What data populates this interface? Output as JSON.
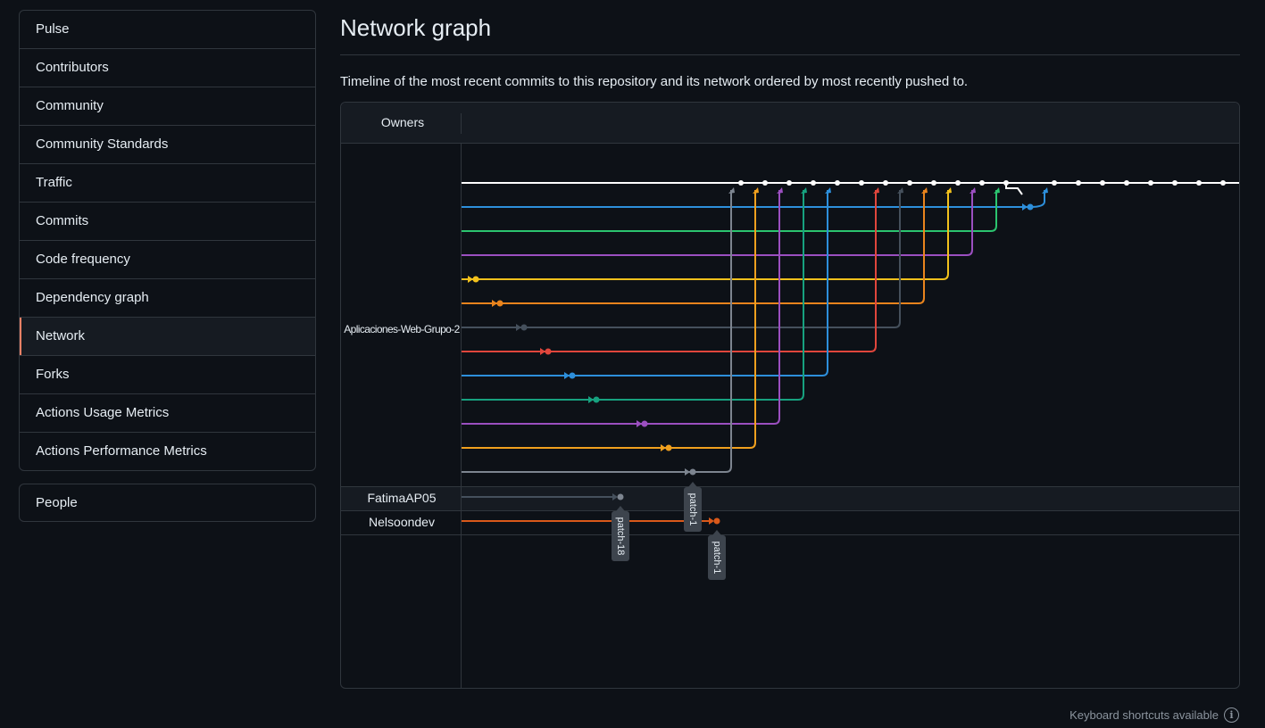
{
  "sidebar": {
    "items": [
      {
        "label": "Pulse"
      },
      {
        "label": "Contributors"
      },
      {
        "label": "Community"
      },
      {
        "label": "Community Standards"
      },
      {
        "label": "Traffic"
      },
      {
        "label": "Commits"
      },
      {
        "label": "Code frequency"
      },
      {
        "label": "Dependency graph"
      },
      {
        "label": "Network",
        "active": true
      },
      {
        "label": "Forks"
      },
      {
        "label": "Actions Usage Metrics"
      },
      {
        "label": "Actions Performance Metrics"
      }
    ],
    "secondary": [
      {
        "label": "People"
      }
    ]
  },
  "page": {
    "title": "Network graph",
    "description": "Timeline of the most recent commits to this repository and its network ordered by most recently pushed to."
  },
  "graph": {
    "owners_header": "Owners",
    "owners": [
      "Aplicaciones-Web-Grupo-2",
      "FatimaAP05",
      "Nelsoondev"
    ],
    "branch_labels": [
      "patch-1",
      "patch-18",
      "patch-1"
    ],
    "colors": {
      "white": "#ffffff",
      "blue": "#2d8fdb",
      "green": "#2bc46f",
      "purple": "#9b4fc0",
      "yellow": "#f2c11c",
      "orange": "#e9841d",
      "slate": "#45505c",
      "red": "#e0463c",
      "teal": "#17a17f",
      "amber": "#f0a01e",
      "gray": "#7d8590",
      "dark-orange": "#d9591a"
    }
  },
  "footer": {
    "keyboard_hint": "Keyboard shortcuts available",
    "info_icon": "info-icon"
  }
}
